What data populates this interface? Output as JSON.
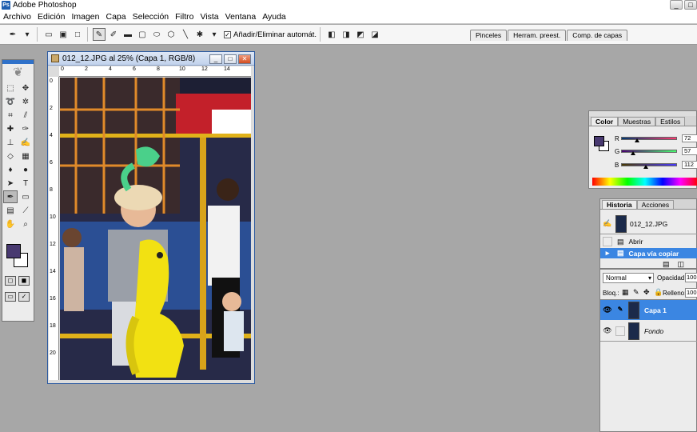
{
  "app": {
    "title": "Adobe Photoshop",
    "icon_label": "Ps"
  },
  "window_buttons": [
    "_",
    "□"
  ],
  "menu": [
    "Archivo",
    "Edición",
    "Imagen",
    "Capa",
    "Selección",
    "Filtro",
    "Vista",
    "Ventana",
    "Ayuda"
  ],
  "options_bar": {
    "auto_add_delete_label": "Añadir/Eliminar automát.",
    "auto_add_delete_checked": true
  },
  "palette_well": [
    "Pinceles",
    "Herram. preest.",
    "Comp. de capas"
  ],
  "document": {
    "title": "012_12.JPG al 25% (Capa 1, RGB/8)",
    "ruler_h": [
      "0",
      "2",
      "4",
      "6",
      "8",
      "10",
      "12",
      "14"
    ],
    "ruler_v": [
      "0",
      "2",
      "4",
      "6",
      "8",
      "10",
      "12",
      "14",
      "16",
      "18",
      "20"
    ]
  },
  "color_panel": {
    "tabs": [
      "Color",
      "Muestras",
      "Estilos"
    ],
    "active_tab": "Color",
    "foreground": "#483970",
    "channels": [
      {
        "label": "R",
        "value": "72",
        "fraction": 0.28
      },
      {
        "label": "G",
        "value": "57",
        "fraction": 0.22
      },
      {
        "label": "B",
        "value": "112",
        "fraction": 0.44
      }
    ]
  },
  "history_panel": {
    "tabs": [
      "Historia",
      "Acciones"
    ],
    "active_tab": "Historia",
    "snapshot": "012_12.JPG",
    "items": [
      "Abrir",
      "Capa vía copiar"
    ],
    "selected_item": "Capa vía copiar"
  },
  "layers_panel": {
    "blend_mode": "Normal",
    "opacity_label": "Opacidad:",
    "opacity_value": "100",
    "lock_label": "Bloq.:",
    "fill_label": "Relleno:",
    "fill_value": "100",
    "layers": [
      {
        "name": "Capa 1",
        "selected": true
      },
      {
        "name": "Fondo",
        "selected": false
      }
    ]
  },
  "colors": {
    "accent": "#3b86e2",
    "foreground_swatch": "#483970",
    "workspace": "#a7a7a7"
  }
}
